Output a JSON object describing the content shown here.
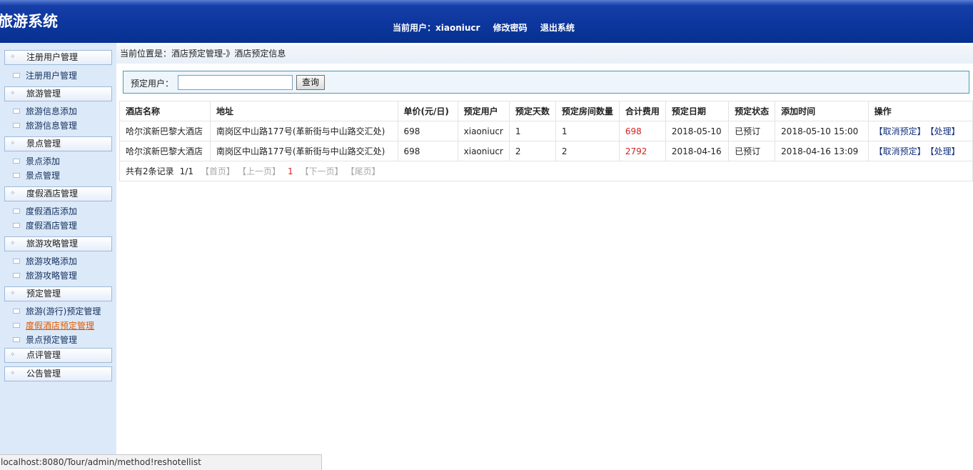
{
  "header": {
    "title": "旅游系统",
    "current_user_label": "当前用户：",
    "current_user": "xiaoniucr",
    "change_password": "修改密码",
    "logout": "退出系统"
  },
  "sidebar": {
    "groups": [
      {
        "label": "注册用户管理",
        "items": [
          "注册用户管理"
        ]
      },
      {
        "label": "旅游管理",
        "items": [
          "旅游信息添加",
          "旅游信息管理"
        ]
      },
      {
        "label": "景点管理",
        "items": [
          "景点添加",
          "景点管理"
        ]
      },
      {
        "label": "度假酒店管理",
        "items": [
          "度假酒店添加",
          "度假酒店管理"
        ]
      },
      {
        "label": "旅游攻略管理",
        "items": [
          "旅游攻略添加",
          "旅游攻略管理"
        ]
      },
      {
        "label": "预定管理",
        "items": [
          "旅游(游行)预定管理",
          "度假酒店预定管理",
          "景点预定管理"
        ]
      },
      {
        "label": "点评管理",
        "items": []
      },
      {
        "label": "公告管理",
        "items": []
      }
    ]
  },
  "breadcrumb": "当前位置是：酒店预定管理-》酒店预定信息",
  "search": {
    "label": "预定用户：",
    "value": "",
    "placeholder": "",
    "button": "查询"
  },
  "table": {
    "headers": [
      "酒店名称",
      "地址",
      "单价(元/日)",
      "预定用户",
      "预定天数",
      "预定房间数量",
      "合计费用",
      "预定日期",
      "预定状态",
      "添加时间",
      "操作"
    ],
    "rows": [
      [
        "哈尔滨新巴黎大酒店",
        "南岗区中山路177号(革新街与中山路交汇处)",
        "698",
        "xiaoniucr",
        "1",
        "1",
        "698",
        "2018-05-10",
        "已预订",
        "2018-05-10 15:00"
      ],
      [
        "哈尔滨新巴黎大酒店",
        "南岗区中山路177号(革新街与中山路交汇处)",
        "698",
        "xiaoniucr",
        "2",
        "2",
        "2792",
        "2018-04-16",
        "已预订",
        "2018-04-16 13:09"
      ]
    ],
    "actions": [
      "【取消预定】",
      "【处理】"
    ]
  },
  "pager": {
    "total": "共有2条记录",
    "page": "1/1",
    "first": "【首页】",
    "prev": "【上一页】",
    "current": "1",
    "next": "【下一页】",
    "last": "【尾页】"
  },
  "statusbar": "localhost:8080/Tour/admin/method!reshotellist",
  "colors": {
    "header": "#0d379f",
    "sidebar": "#dce9f8",
    "cost": "#d42020",
    "active_link": "#e05a00"
  }
}
